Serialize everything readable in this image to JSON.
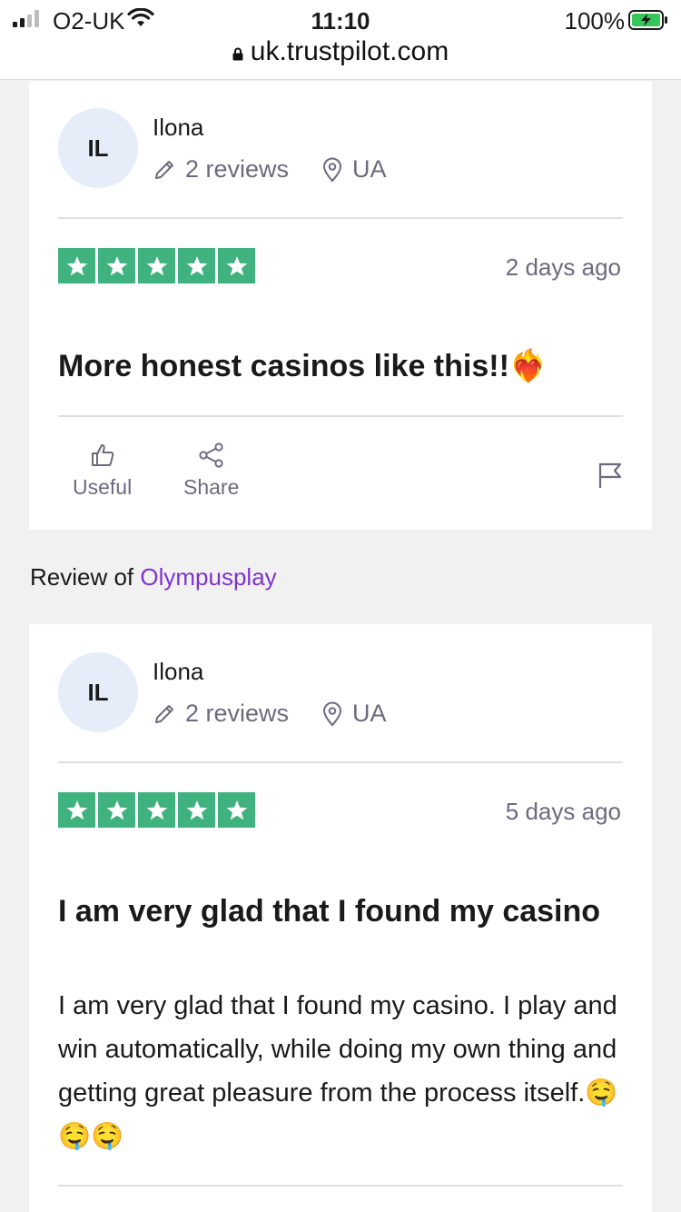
{
  "status_bar": {
    "carrier": "O2-UK",
    "time": "11:10",
    "battery": "100%",
    "url": "uk.trustpilot.com"
  },
  "reviews": [
    {
      "avatar_initials": "IL",
      "name": "Ilona",
      "review_count": "2 reviews",
      "country": "UA",
      "rating": 5,
      "date": "2 days ago",
      "title": "More honest casinos like this!!❤️‍🔥",
      "body": "",
      "useful_label": "Useful",
      "share_label": "Share"
    },
    {
      "avatar_initials": "IL",
      "name": "Ilona",
      "review_count": "2 reviews",
      "country": "UA",
      "rating": 5,
      "date": "5 days ago",
      "title": "I am very glad that I found my casino",
      "body": "I am very glad that I found my casino. I play and win automatically, while doing my own thing and getting great pleasure from the process itself.🤤🤤🤤"
    }
  ],
  "review_of": {
    "prefix": "Review of ",
    "company": "Olympusplay"
  },
  "colors": {
    "star_green": "#3fb27f",
    "link_purple": "#7d35d0",
    "muted_text": "#6b6b80",
    "avatar_bg": "#e6edf8"
  },
  "icons": [
    "pencil-icon",
    "location-pin-icon",
    "thumbs-up-icon",
    "share-icon",
    "flag-icon",
    "star-icon",
    "lock-icon",
    "wifi-icon",
    "battery-icon"
  ]
}
